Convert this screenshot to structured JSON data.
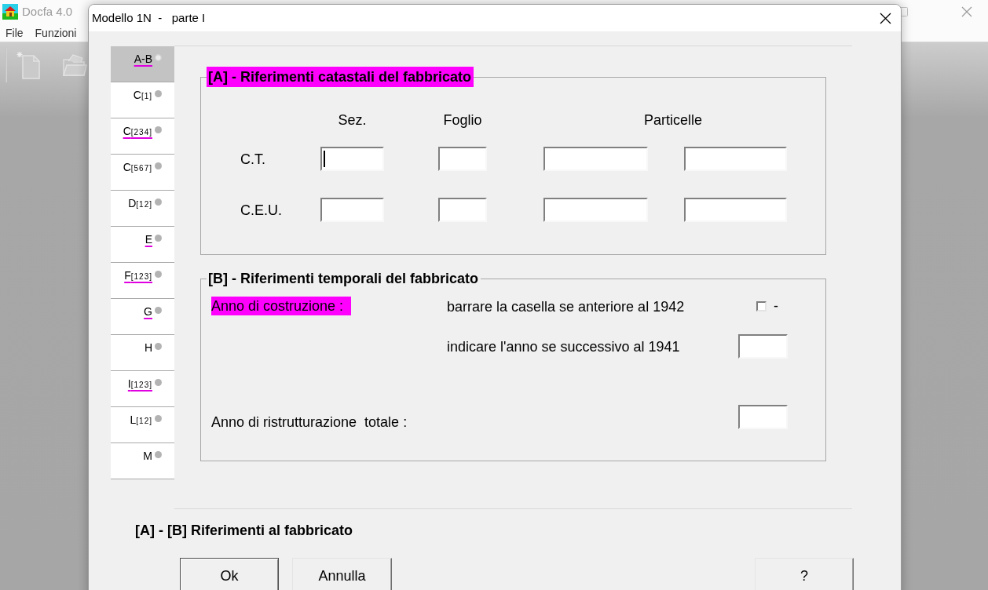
{
  "app_window": {
    "title": "Docfa 4.0",
    "menu": [
      "File",
      "Funzioni"
    ]
  },
  "dialog": {
    "title": "Modello 1N  -   parte I",
    "tabs": [
      {
        "label": "A-B",
        "selected": true,
        "underlined": true
      },
      {
        "label": "C",
        "suffix": "[1]",
        "selected": false,
        "underlined": false
      },
      {
        "label": "C",
        "suffix": "[234]",
        "selected": false,
        "underlined": true
      },
      {
        "label": "C",
        "suffix": "[567]",
        "selected": false,
        "underlined": false
      },
      {
        "label": "D",
        "suffix": "[12]",
        "selected": false,
        "underlined": false
      },
      {
        "label": "E",
        "selected": false,
        "underlined": true
      },
      {
        "label": "F",
        "suffix": "[123]",
        "selected": false,
        "underlined": true
      },
      {
        "label": "G",
        "selected": false,
        "underlined": true
      },
      {
        "label": "H",
        "selected": false,
        "underlined": false
      },
      {
        "label": "I",
        "suffix": "[123]",
        "selected": false,
        "underlined": true
      },
      {
        "label": "L",
        "suffix": "[12]",
        "selected": false,
        "underlined": false
      },
      {
        "label": "M",
        "selected": false,
        "underlined": false
      }
    ],
    "section_a": {
      "legend": "[A] - Riferimenti catastali del fabbricato",
      "highlighted": true,
      "column_headers": [
        "Sez.",
        "Foglio",
        "Particelle"
      ],
      "rows": [
        {
          "label": "C.T.",
          "fields": [
            {
              "focused": true
            },
            {
              "focused": false
            },
            {
              "focused": false
            },
            {
              "focused": false
            }
          ]
        },
        {
          "label": "C.E.U.",
          "fields": [
            {
              "focused": false
            },
            {
              "focused": false
            },
            {
              "focused": false
            },
            {
              "focused": false
            }
          ]
        }
      ]
    },
    "section_b": {
      "legend": "[B] - Riferimenti temporali del fabbricato",
      "highlighted": false,
      "construction_label": {
        "text": "Anno di costruzione :",
        "highlighted": true
      },
      "before_1942": {
        "text": "barrare la casella se anteriore al 1942",
        "checked": false,
        "suffix": "-"
      },
      "after_1941": {
        "text": "indicare l'anno se successivo al 1941"
      },
      "renovation_label": {
        "text": "Anno di ristrutturazione  totale :",
        "highlighted": false
      }
    },
    "caption": "[A] - [B] Riferimenti al fabbricato",
    "buttons": [
      {
        "label": "Ok",
        "default": true
      },
      {
        "label": "Annulla",
        "default": false
      },
      {
        "label": "?",
        "default": false
      }
    ]
  }
}
